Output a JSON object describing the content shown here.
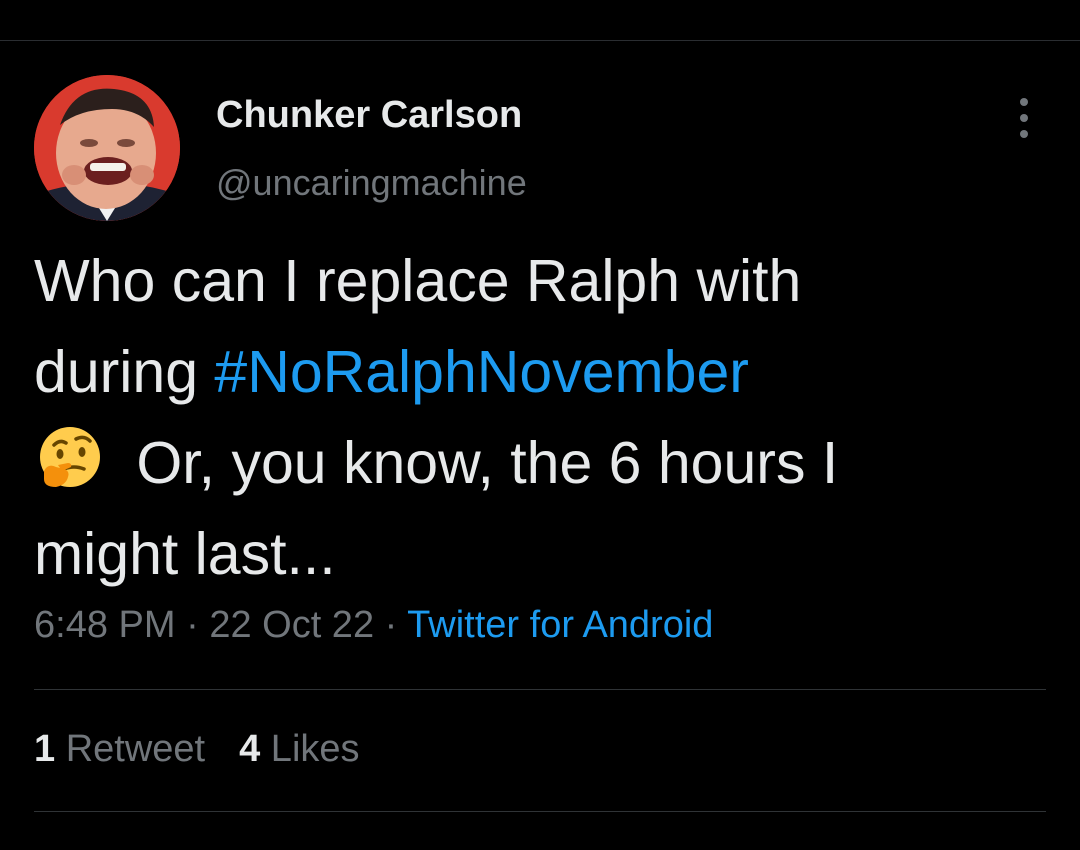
{
  "tweet": {
    "author": {
      "display_name": "Chunker Carlson",
      "handle": "@uncaringmachine"
    },
    "text": {
      "line1": "Who can I replace Ralph with",
      "line2_prefix": "during ",
      "hashtag": "#NoRalphNovember",
      "emoji": "thinking-face-icon",
      "line3_text": " Or, you know, the 6 hours I",
      "line4": "might last..."
    },
    "meta": {
      "time": "6:48 PM",
      "separator": " · ",
      "date": "22 Oct 22",
      "source": "Twitter for Android"
    },
    "stats": {
      "retweets_count": "1",
      "retweets_label": " Retweet",
      "likes_count": "4",
      "likes_label": " Likes"
    }
  },
  "colors": {
    "background": "#000000",
    "text_primary": "#e7e9ea",
    "text_secondary": "#71767b",
    "link_blue": "#1d9bf0",
    "divider": "#2f3336",
    "avatar_bg": "#d93a2e"
  },
  "icons": {
    "more": "more-options-icon",
    "avatar": "profile-avatar"
  }
}
